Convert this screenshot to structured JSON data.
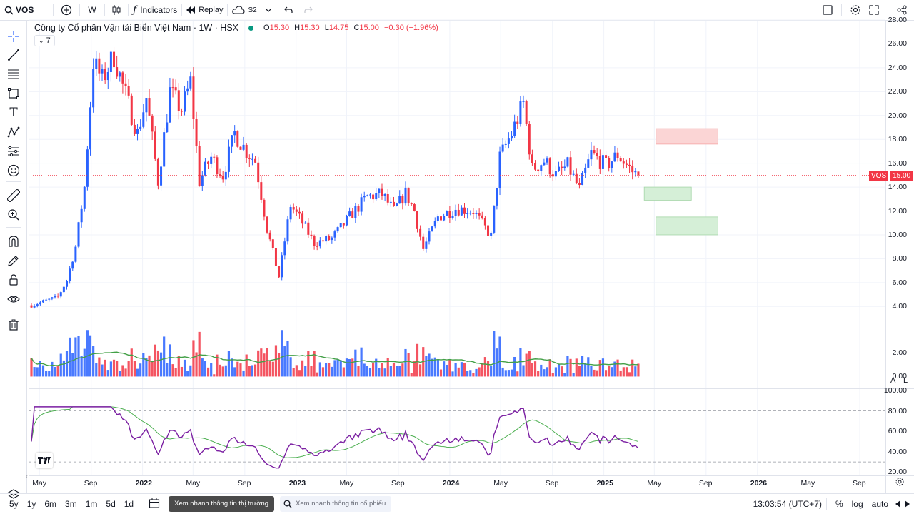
{
  "topbar": {
    "symbol": "VOS",
    "interval": "W",
    "indicators_label": "Indicators",
    "replay_label": "Replay",
    "cloud_label": "S2"
  },
  "legend": {
    "title": "Công ty Cổ phần Vận tải Biển Việt Nam · 1W · HSX",
    "o_label": "O",
    "o": "15.30",
    "h_label": "H",
    "h": "15.30",
    "l_label": "L",
    "l": "14.75",
    "c_label": "C",
    "c": "15.00",
    "change": "−0.30 (−1.96%)",
    "collapse_count": "7",
    "status_color": "#089981"
  },
  "price_axis": {
    "ticks": [
      "28.00",
      "26.00",
      "24.00",
      "22.00",
      "20.00",
      "18.00",
      "16.00",
      "14.00",
      "12.00",
      "10.00",
      "8.00",
      "6.00",
      "4.00",
      "2.00",
      "0.00"
    ],
    "last_symbol": "VOS",
    "last_price": "15.00"
  },
  "rsi_axis": {
    "ticks": [
      "100.00",
      "80.00",
      "60.00",
      "40.00",
      "20.00"
    ]
  },
  "time_axis": {
    "labels": [
      {
        "t": "May",
        "bold": false
      },
      {
        "t": "Sep",
        "bold": false
      },
      {
        "t": "2022",
        "bold": true
      },
      {
        "t": "May",
        "bold": false
      },
      {
        "t": "Sep",
        "bold": false
      },
      {
        "t": "2023",
        "bold": true
      },
      {
        "t": "May",
        "bold": false
      },
      {
        "t": "Sep",
        "bold": false
      },
      {
        "t": "2024",
        "bold": true
      },
      {
        "t": "May",
        "bold": false
      },
      {
        "t": "Sep",
        "bold": false
      },
      {
        "t": "2025",
        "bold": true
      },
      {
        "t": "May",
        "bold": false
      },
      {
        "t": "Sep",
        "bold": false
      },
      {
        "t": "2026",
        "bold": true
      },
      {
        "t": "May",
        "bold": false
      },
      {
        "t": "Sep",
        "bold": false
      }
    ]
  },
  "scale_buttons": {
    "a": "A",
    "l": "L"
  },
  "bottombar": {
    "ranges": [
      "5y",
      "1y",
      "6m",
      "3m",
      "1m",
      "5d",
      "1d"
    ],
    "market_btn": "Xem nhanh thông tin thị trường",
    "stock_placeholder": "Xem nhanh thông tin cổ phiếu",
    "clock": "13:03:54 (UTC+7)",
    "pct": "%",
    "log": "log",
    "auto": "auto"
  },
  "colors": {
    "up": "#2962ff",
    "down": "#f23645",
    "volume_ma": "#43a047",
    "rsi": "#7b1fa2",
    "rsi_ma": "#4caf50",
    "zone_red": "#fbd5d5",
    "zone_green": "#d5efd7"
  },
  "chart_data": {
    "type": "candlestick",
    "anchors": [
      [
        "2021-04-12",
        4.1
      ],
      [
        "2021-06-14",
        4.8
      ],
      [
        "2021-07-05",
        6.2
      ],
      [
        "2021-07-26",
        9.0
      ],
      [
        "2021-08-16",
        14.0
      ],
      [
        "2021-09-06",
        24.5
      ],
      [
        "2021-09-27",
        23.0
      ],
      [
        "2021-10-25",
        25.0
      ],
      [
        "2021-11-15",
        22.5
      ],
      [
        "2021-12-20",
        18.5
      ],
      [
        "2022-01-10",
        21.5
      ],
      [
        "2022-02-07",
        14.5
      ],
      [
        "2022-03-07",
        22.0
      ],
      [
        "2022-04-04",
        20.5
      ],
      [
        "2022-04-25",
        22.8
      ],
      [
        "2022-05-16",
        14.5
      ],
      [
        "2022-06-13",
        16.5
      ],
      [
        "2022-07-11",
        15.0
      ],
      [
        "2022-08-08",
        18.5
      ],
      [
        "2022-09-05",
        17.0
      ],
      [
        "2022-09-26",
        16.2
      ],
      [
        "2022-10-24",
        10.5
      ],
      [
        "2022-11-21",
        6.5
      ],
      [
        "2022-12-19",
        12.5
      ],
      [
        "2023-01-16",
        11.0
      ],
      [
        "2023-02-13",
        9.3
      ],
      [
        "2023-03-27",
        9.7
      ],
      [
        "2023-05-08",
        11.5
      ],
      [
        "2023-06-19",
        13.2
      ],
      [
        "2023-07-24",
        13.4
      ],
      [
        "2023-08-21",
        12.0
      ],
      [
        "2023-09-18",
        13.5
      ],
      [
        "2023-10-09",
        12.0
      ],
      [
        "2023-10-30",
        8.8
      ],
      [
        "2023-12-04",
        11.5
      ],
      [
        "2024-01-15",
        12.2
      ],
      [
        "2024-02-26",
        12.0
      ],
      [
        "2024-04-08",
        9.9
      ],
      [
        "2024-04-29",
        16.5
      ],
      [
        "2024-05-27",
        18.5
      ],
      [
        "2024-06-24",
        21.0
      ],
      [
        "2024-07-15",
        15.5
      ],
      [
        "2024-08-12",
        16.2
      ],
      [
        "2024-09-09",
        15.0
      ],
      [
        "2024-10-07",
        15.8
      ],
      [
        "2024-11-04",
        13.8
      ],
      [
        "2024-12-02",
        16.8
      ],
      [
        "2025-01-06",
        15.8
      ],
      [
        "2025-02-03",
        16.7
      ],
      [
        "2025-03-10",
        15.3
      ],
      [
        "2025-03-24",
        15.0
      ]
    ],
    "volume_axis": {
      "min": 0,
      "max": 4
    },
    "zones": [
      {
        "color": "red",
        "from": "2025-05-05",
        "to": "2025-09-29",
        "low": 17.6,
        "high": 18.9
      },
      {
        "color": "green",
        "from": "2025-04-07",
        "to": "2025-07-28",
        "low": 12.9,
        "high": 14.0
      },
      {
        "color": "green",
        "from": "2025-05-05",
        "to": "2025-09-29",
        "low": 10.0,
        "high": 11.5
      }
    ],
    "rsi_levels": [
      80,
      30
    ],
    "ylim": [
      4,
      28
    ],
    "rsi_ylim": [
      20,
      100
    ]
  }
}
